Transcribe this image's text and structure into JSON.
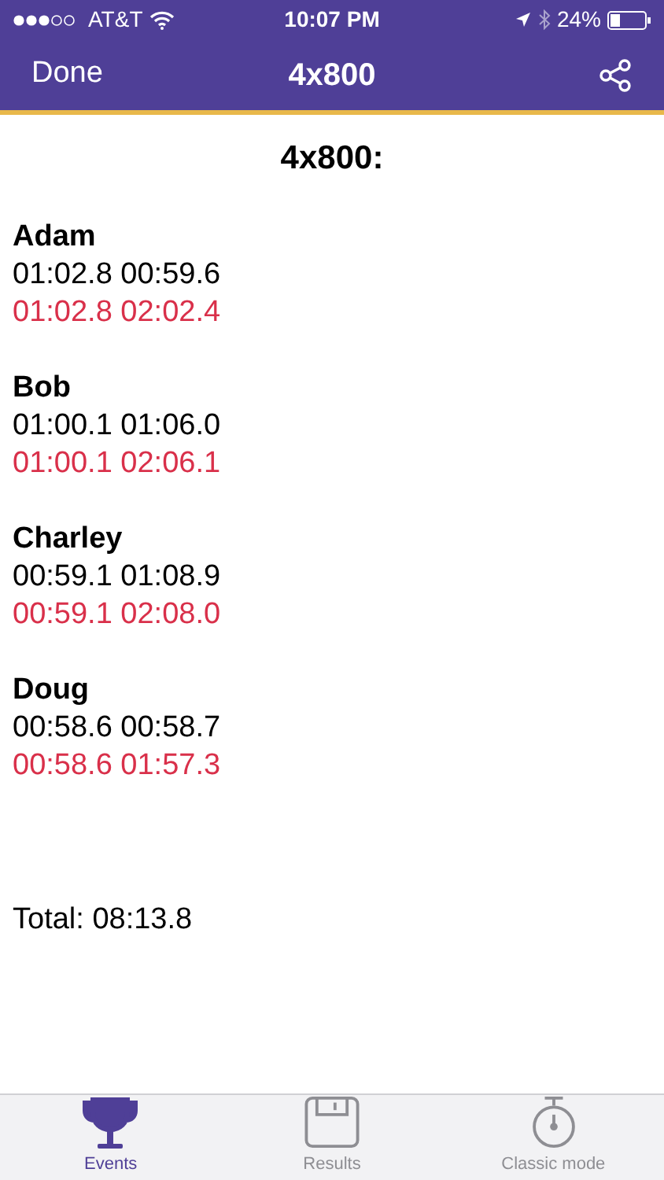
{
  "status_bar": {
    "carrier": "AT&T",
    "time": "10:07 PM",
    "battery": "24%"
  },
  "nav_bar": {
    "left_button": "Done",
    "title": "4x800"
  },
  "heading": "4x800:",
  "runners": [
    {
      "name": "Adam",
      "splits": "01:02.8 00:59.6",
      "cumulative": "01:02.8 02:02.4"
    },
    {
      "name": "Bob",
      "splits": "01:00.1 01:06.0",
      "cumulative": "01:00.1 02:06.1"
    },
    {
      "name": "Charley",
      "splits": "00:59.1 01:08.9",
      "cumulative": "00:59.1 02:08.0"
    },
    {
      "name": "Doug",
      "splits": "00:58.6 00:58.7",
      "cumulative": "00:58.6 01:57.3"
    }
  ],
  "total": "Total: 08:13.8",
  "tabs": [
    {
      "label": "Events",
      "kind": "trophy",
      "selected": true
    },
    {
      "label": "Results",
      "kind": "disk",
      "selected": false
    },
    {
      "label": "Classic mode",
      "kind": "stopwatch",
      "selected": false
    }
  ]
}
